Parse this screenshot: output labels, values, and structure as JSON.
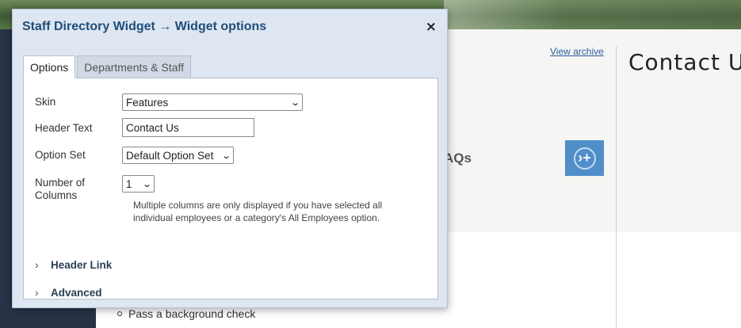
{
  "background": {
    "view_archive": "View archive",
    "contact_heading": "Contact U",
    "faq_text": "AQs",
    "list_item": "Pass a background check"
  },
  "modal": {
    "title": "Staff Directory Widget → Widget options",
    "close_glyph": "×",
    "tabs": [
      {
        "label": "Options",
        "active": true
      },
      {
        "label": "Departments & Staff",
        "active": false
      }
    ],
    "fields": {
      "skin": {
        "label": "Skin",
        "value": "Features"
      },
      "header_text": {
        "label": "Header Text",
        "value": "Contact Us"
      },
      "option_set": {
        "label": "Option Set",
        "value": "Default Option Set"
      },
      "columns": {
        "label": "Number of Columns",
        "value": "1"
      }
    },
    "columns_hint": "Multiple columns are only displayed if you have selected all individual employees or a category's All Employees option.",
    "sections": [
      {
        "label": "Header Link"
      },
      {
        "label": "Advanced"
      }
    ]
  },
  "icons": {
    "close": "close-icon",
    "dropdown": "chevron-down-icon",
    "expand": "chevron-right-icon",
    "faq_button": "arrow-plus-icon"
  },
  "colors": {
    "modal_bg": "#dde6f1",
    "title": "#1f4e7a",
    "rail": "#283347",
    "faq_button": "#4f8ec9"
  }
}
